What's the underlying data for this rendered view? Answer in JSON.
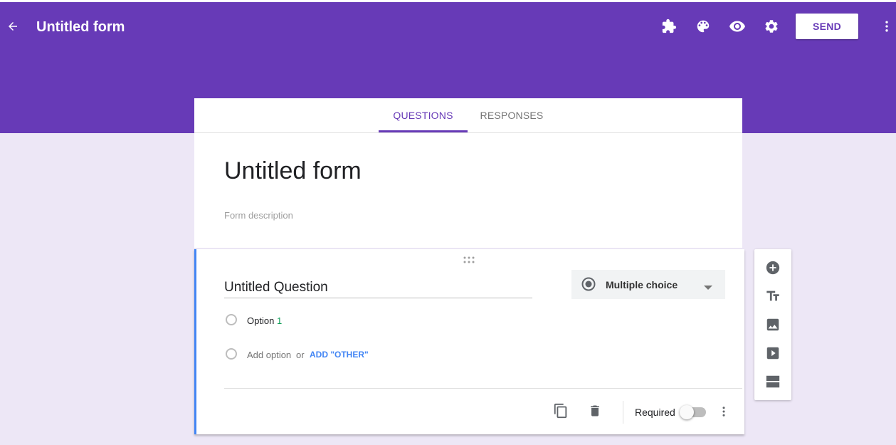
{
  "header": {
    "title": "Untitled form",
    "send_label": "SEND",
    "icons": [
      "back-arrow-icon",
      "addons-puzzle-icon",
      "palette-icon",
      "preview-eye-icon",
      "settings-gear-icon",
      "more-vert-icon"
    ],
    "bg_color": "#673ab7"
  },
  "tabs": [
    {
      "label": "QUESTIONS",
      "active": true
    },
    {
      "label": "RESPONSES",
      "active": false
    }
  ],
  "form": {
    "title": "Untitled form",
    "description_placeholder": "Form description"
  },
  "question": {
    "title": "Untitled Question",
    "type": "Multiple choice",
    "options": [
      {
        "label": "Option",
        "number": "1"
      }
    ],
    "add_option": "Add option",
    "or": "or",
    "add_other": "ADD \"OTHER\"",
    "required_label": "Required",
    "required_on": false
  },
  "side_toolbar": {
    "icons": [
      "add-question-icon",
      "add-title-text-icon",
      "add-image-icon",
      "add-video-icon",
      "add-section-icon"
    ]
  },
  "colors": {
    "accent": "#673ab7",
    "page_bg": "#ede7f6",
    "active_card_border": "#4285f4",
    "link_blue": "#4285f4"
  }
}
